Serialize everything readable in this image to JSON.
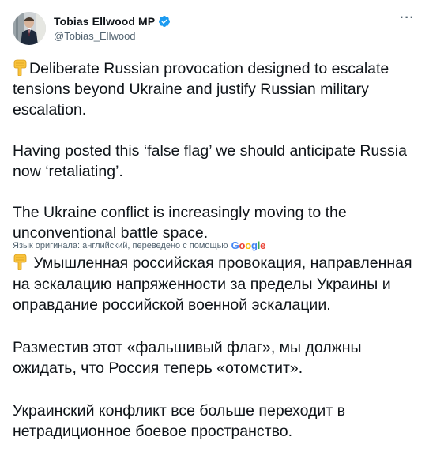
{
  "author": {
    "display_name": "Tobias Ellwood MP",
    "handle": "@Tobias_Ellwood",
    "verified": true
  },
  "more_button": "···",
  "tweet": {
    "paragraphs": [
      "Deliberate Russian provocation designed to escalate tensions beyond Ukraine and justify Russian military escalation.",
      "Having posted this ‘false flag’ we should anticipate Russia now ‘retaliating’.",
      "The Ukraine conflict is increasingly moving to the unconventional battle space."
    ]
  },
  "translation": {
    "note": "Язык оригинала: английский, переведено с помощью",
    "provider": "Google",
    "paragraphs": [
      "Умышленная российская провокация, направленная на эскалацию напряженности за пределы Украины и оправдание российской военной эскалации.",
      "Разместив этот «фальшивый флаг», мы должны ожидать, что Россия теперь «отомстит».",
      "Украинский конфликт все больше переходит в нетрадиционное боевое пространство."
    ]
  },
  "icons": {
    "avatar": "profile-photo",
    "verified": "verified-badge-icon",
    "more": "more-options-icon",
    "emoji": "backhand-index-pointing-down-emoji"
  },
  "colors": {
    "text": "#0f1419",
    "secondary": "#536471",
    "verified": "#1d9bf0",
    "emoji": "#f8c23b"
  }
}
